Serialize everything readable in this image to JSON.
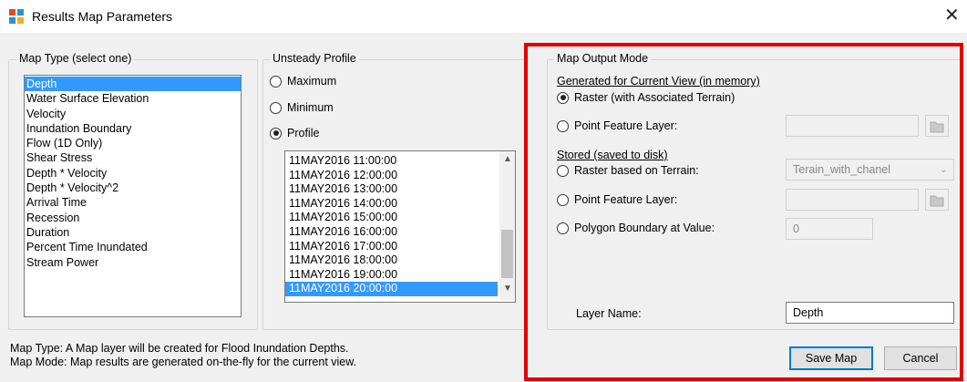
{
  "window": {
    "title": "Results Map Parameters"
  },
  "map_type": {
    "legend": "Map Type (select one)",
    "items": [
      "Depth",
      "Water Surface Elevation",
      "Velocity",
      "Inundation Boundary",
      "Flow (1D Only)",
      "Shear Stress",
      "Depth * Velocity",
      "Depth * Velocity^2",
      "Arrival Time",
      "Recession",
      "Duration",
      "Percent Time Inundated",
      "Stream Power"
    ],
    "selected": "Depth"
  },
  "unsteady": {
    "legend": "Unsteady Profile",
    "maximum": "Maximum",
    "minimum": "Minimum",
    "profile": "Profile",
    "times": [
      "11MAY2016 11:00:00",
      "11MAY2016 12:00:00",
      "11MAY2016 13:00:00",
      "11MAY2016 14:00:00",
      "11MAY2016 15:00:00",
      "11MAY2016 16:00:00",
      "11MAY2016 17:00:00",
      "11MAY2016 18:00:00",
      "11MAY2016 19:00:00",
      "11MAY2016 20:00:00"
    ],
    "selected_time": "11MAY2016 20:00:00"
  },
  "output": {
    "legend": "Map Output Mode",
    "generated_header": "Generated for Current View (in memory)",
    "raster_assoc": "Raster (with Associated Terrain)",
    "point_layer_1": "Point Feature Layer:",
    "stored_header": "Stored (saved to disk)",
    "raster_terrain": "Raster based on Terrain:",
    "terrain_value": "Terain_with_chanel",
    "point_layer_2": "Point Feature Layer:",
    "polygon_boundary": "Polygon Boundary at Value:",
    "polygon_value": "0",
    "layer_name_label": "Layer Name:",
    "layer_name_value": "Depth"
  },
  "footer": {
    "map_type_desc": "Map Type: A Map layer will be created for Flood Inundation Depths.",
    "map_mode_desc": "Map Mode: Map results are generated on-the-fly for the current view."
  },
  "buttons": {
    "save": "Save Map",
    "cancel": "Cancel"
  },
  "colors": {
    "selection": "#3399ff",
    "highlight_frame": "#e00000"
  }
}
